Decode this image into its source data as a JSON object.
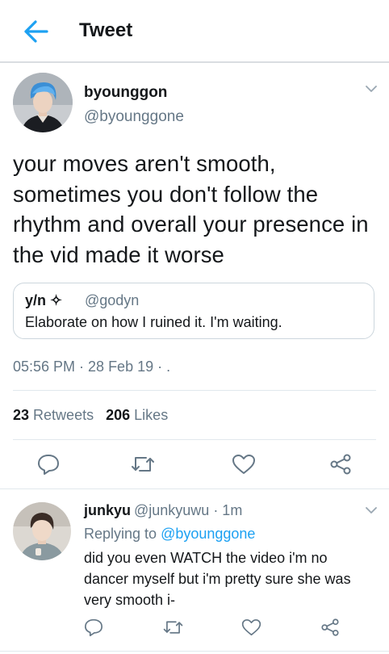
{
  "header": {
    "title": "Tweet"
  },
  "tweet": {
    "name": "byounggon",
    "handle": "@byounggone",
    "text": "your moves aren't smooth, sometimes you don't follow the rhythm and overall your presence in the vid made it worse",
    "quote": {
      "name": "y/n ✧",
      "handle": "@godyn",
      "text": "Elaborate on how I ruined it. I'm waiting."
    },
    "timestamp": "05:56 PM · 28 Feb 19 · .",
    "retweets_count": "23",
    "retweets_label": "Retweets",
    "likes_count": "206",
    "likes_label": "Likes"
  },
  "reply": {
    "name": "junkyu",
    "meta": "@junkyuwu · 1m",
    "replying_prefix": "Replying to",
    "replying_to": "@byounggone",
    "text": "did you even WATCH the video i'm no dancer myself but i'm pretty sure she was very smooth i-"
  },
  "colors": {
    "accent": "#1da1f2",
    "secondary_text": "#657786",
    "icon_gray": "#657786"
  },
  "icons": [
    "back-arrow-icon",
    "chevron-down-icon",
    "reply-icon",
    "retweet-icon",
    "like-icon",
    "share-icon"
  ]
}
